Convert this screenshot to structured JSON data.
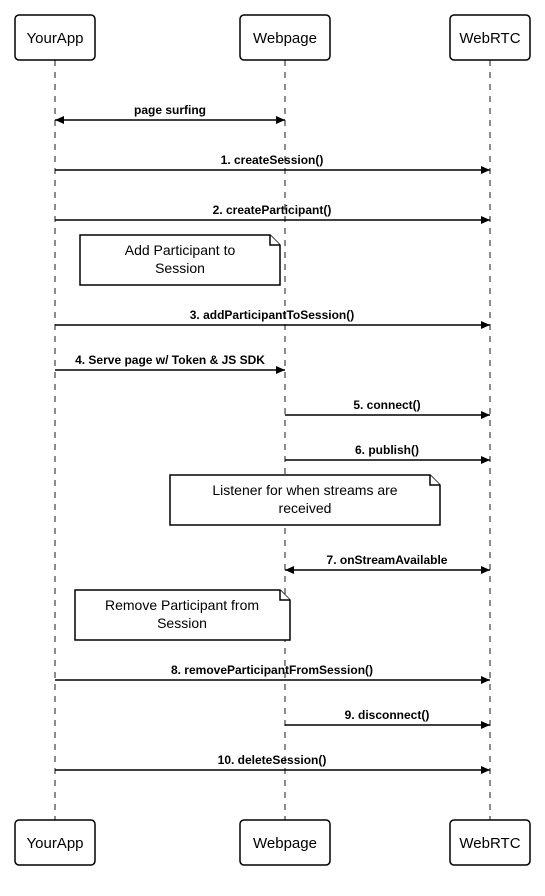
{
  "actors": {
    "a": "YourApp",
    "b": "Webpage",
    "c": "WebRTC"
  },
  "messages": {
    "m0": "page surfing",
    "m1": "1. createSession()",
    "m2": "2. createParticipant()",
    "m3": "3. addParticipantToSession()",
    "m4": "4. Serve page w/ Token & JS SDK",
    "m5": "5. connect()",
    "m6": "6. publish()",
    "m7": "7. onStreamAvailable",
    "m8": "8. removeParticipantFromSession()",
    "m9": "9. disconnect()",
    "m10": "10. deleteSession()"
  },
  "notes": {
    "n1a": "Add Participant to",
    "n1b": "Session",
    "n2a": "Listener for when streams are",
    "n2b": "received",
    "n3a": "Remove Participant from",
    "n3b": "Session"
  }
}
